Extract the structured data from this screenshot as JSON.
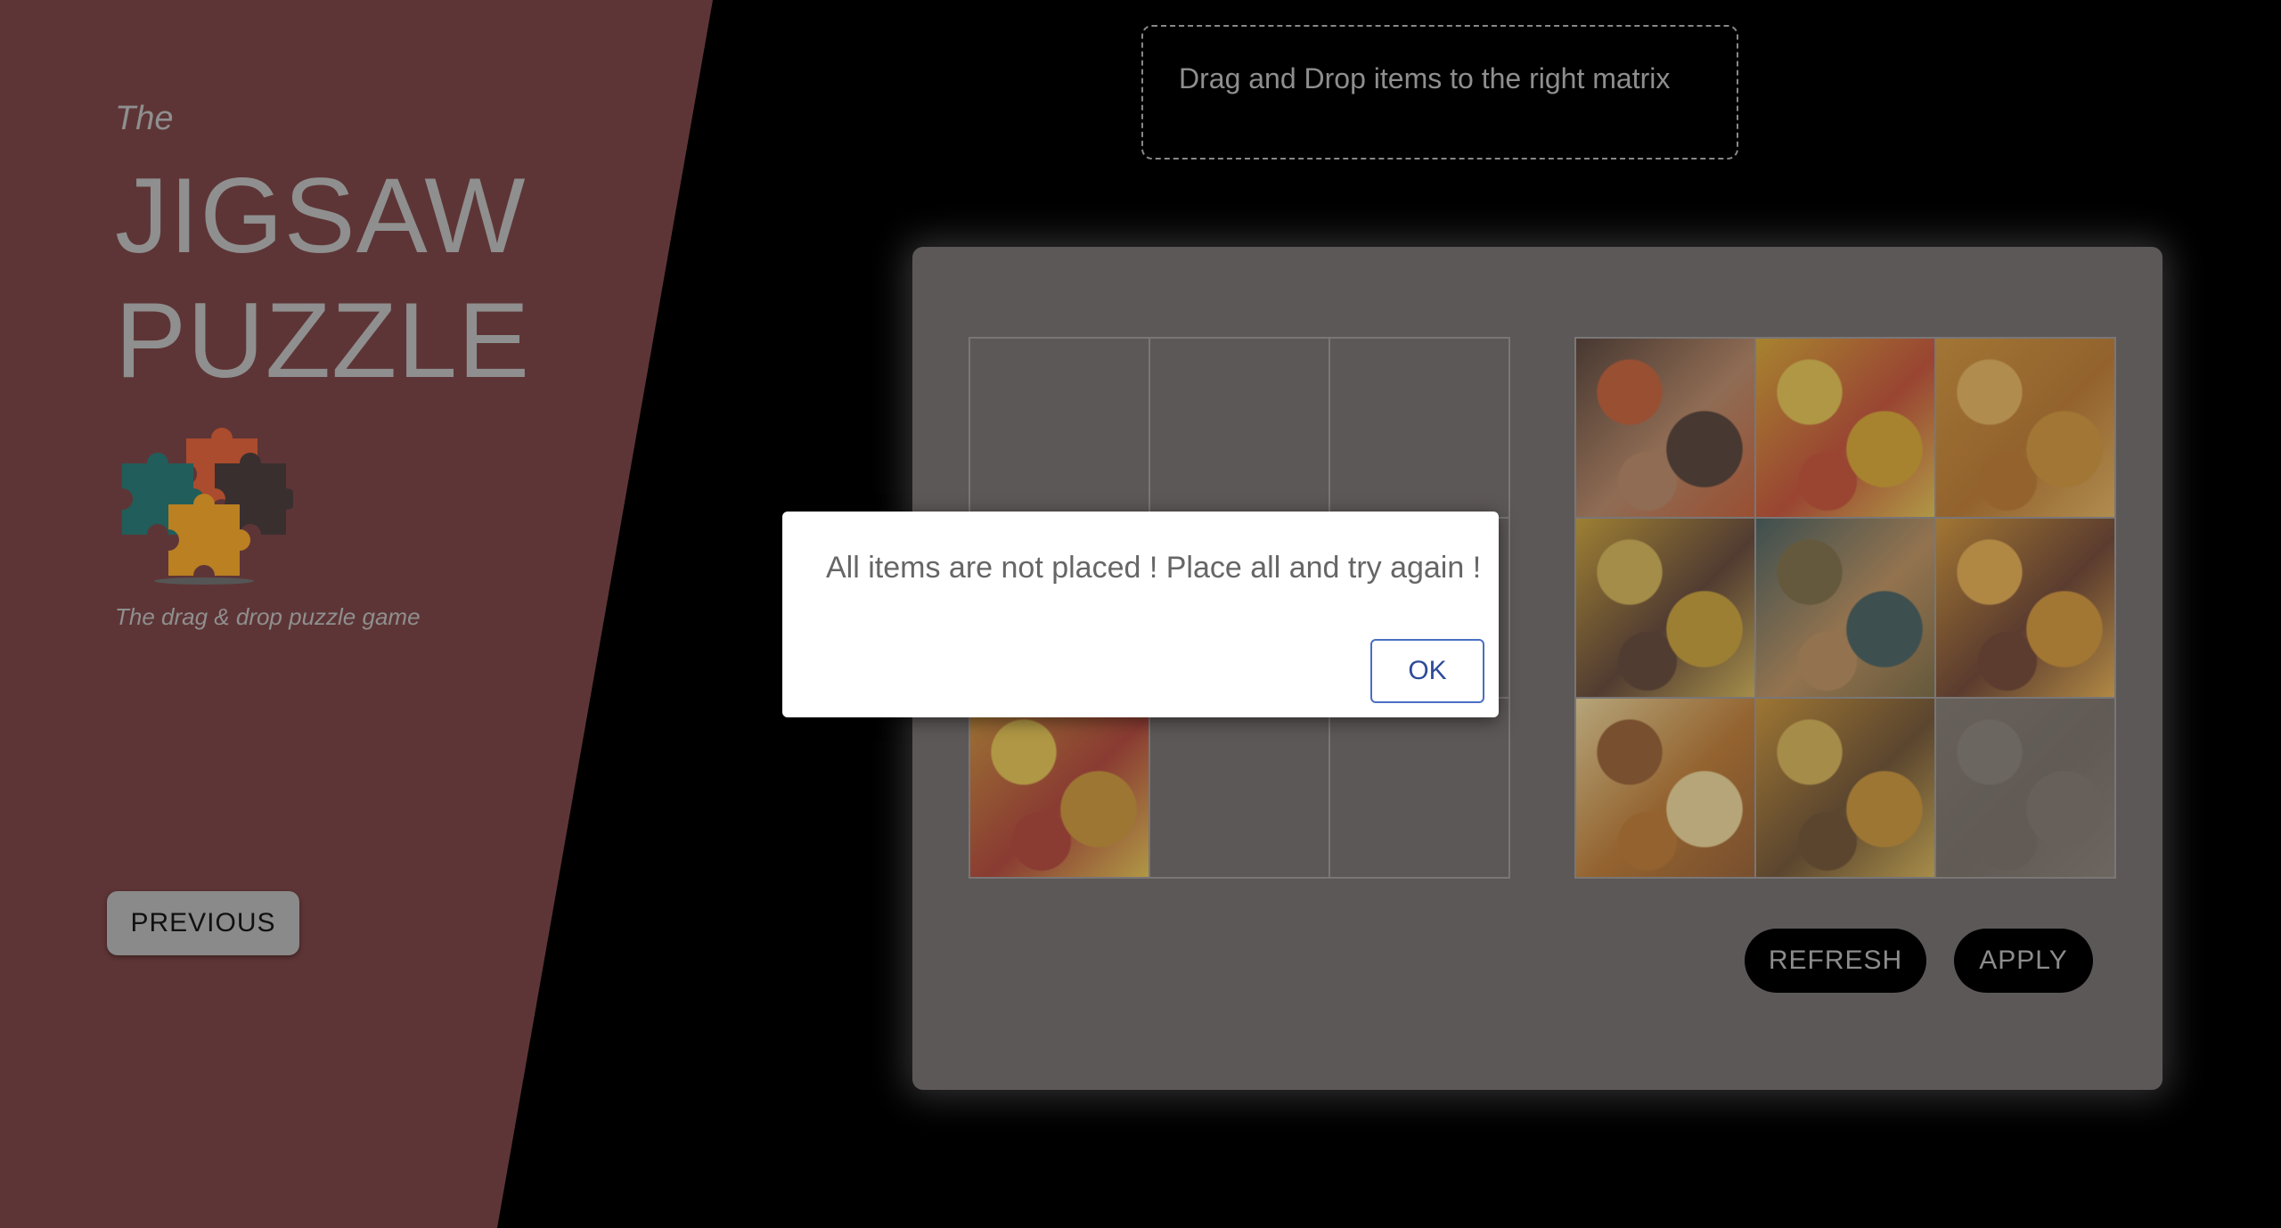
{
  "brand": {
    "the": "The",
    "title_line1": "JIGSAW",
    "title_line2": "PUZZLE",
    "tagline": "The drag & drop puzzle game",
    "logo_icon": "jigsaw-pieces-icon",
    "logo_colors": [
      "#c4542a",
      "#0d6b66",
      "#2d2d2d",
      "#d99a1c"
    ]
  },
  "nav": {
    "previous_label": "PREVIOUS"
  },
  "instructions": {
    "text": "Drag and Drop items to the right matrix"
  },
  "target_grid": {
    "cells": [
      {
        "filled": false
      },
      {
        "filled": false
      },
      {
        "filled": false
      },
      {
        "filled": false
      },
      {
        "filled": false
      },
      {
        "filled": false
      },
      {
        "filled": true,
        "piece": "leaves-red-yellow"
      },
      {
        "filled": false
      },
      {
        "filled": false
      }
    ]
  },
  "source_grid": {
    "pieces": [
      {
        "name": "girl-face",
        "colors": [
          "#3a2418",
          "#b27a52",
          "#c24a1a"
        ]
      },
      {
        "name": "yellow-leaves",
        "colors": [
          "#d9a016",
          "#c2391a",
          "#e8c23a"
        ]
      },
      {
        "name": "orange-leaves",
        "colors": [
          "#d08a1e",
          "#b86a12",
          "#e8b04a"
        ]
      },
      {
        "name": "leaves-branch",
        "colors": [
          "#c89a1c",
          "#4a2a18",
          "#d4b040"
        ]
      },
      {
        "name": "hand-lantern",
        "colors": [
          "#2a4a4a",
          "#b8864a",
          "#6a5a2a"
        ]
      },
      {
        "name": "tree-branches",
        "colors": [
          "#d08a1c",
          "#5a2a14",
          "#e8a838"
        ]
      },
      {
        "name": "sparkle-light",
        "colors": [
          "#f0d890",
          "#b86a14",
          "#8a4a14"
        ]
      },
      {
        "name": "leaves-sparkle",
        "colors": [
          "#c88a1c",
          "#5a3a14",
          "#d8b040"
        ]
      },
      {
        "name": "faded-piece",
        "colors": [
          "#7a7060",
          "#6a6050",
          "#8a8070"
        ]
      }
    ]
  },
  "actions": {
    "refresh_label": "REFRESH",
    "apply_label": "APPLY"
  },
  "dialog": {
    "message": "All items are not placed ! Place all and try again !",
    "ok_label": "OK"
  }
}
